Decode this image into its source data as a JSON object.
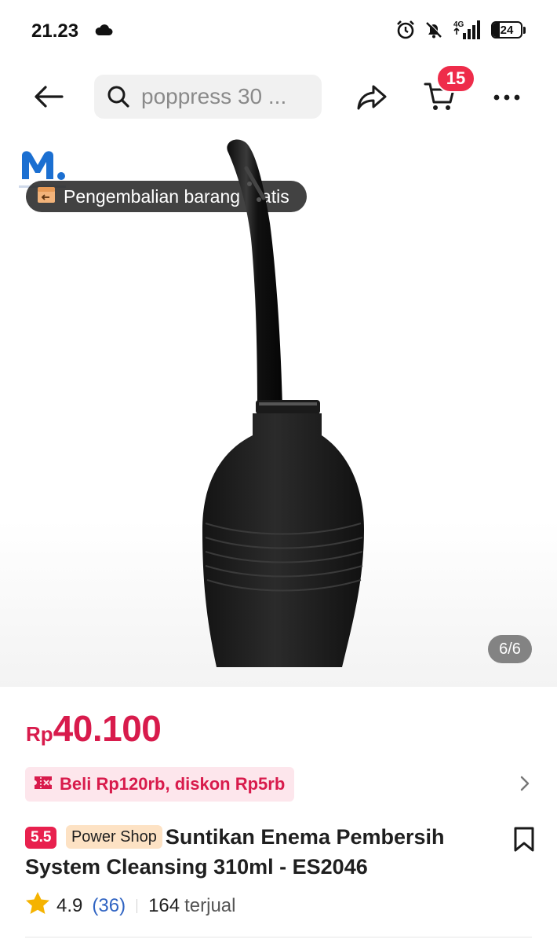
{
  "status_bar": {
    "time": "21.23",
    "network": "4G",
    "battery": "24",
    "icons": [
      "cloud-icon",
      "alarm-icon",
      "bell-off-icon",
      "signal-icon",
      "battery-icon"
    ]
  },
  "header": {
    "search_placeholder": "poppress 30 ...",
    "cart_count": "15",
    "icons": [
      "back-arrow-icon",
      "search-icon",
      "share-icon",
      "cart-icon",
      "more-icon"
    ]
  },
  "product_image": {
    "brand_logo_letter": "M",
    "free_return_label": "Pengembalian barang gratis",
    "image_counter": "6/6"
  },
  "price": {
    "currency": "Rp",
    "value": "40.100"
  },
  "voucher": {
    "label": "Beli Rp120rb, diskon Rp5rb"
  },
  "product": {
    "badge_campaign": "5.5",
    "badge_shop": "Power Shop",
    "title": "Suntikan Enema Pembersih System Cleansing 310ml - ES2046"
  },
  "rating": {
    "value": "4.9",
    "count": "(36)",
    "sold_count": "164",
    "sold_label": "terjual"
  },
  "colors": {
    "price": "#d81b4c",
    "cart_badge": "#ee2c4a",
    "voucher_bg": "#fde6ec",
    "power_shop_badge_bg": "#fde2c4",
    "rating_count": "#2f63c2",
    "star": "#f5b301"
  }
}
